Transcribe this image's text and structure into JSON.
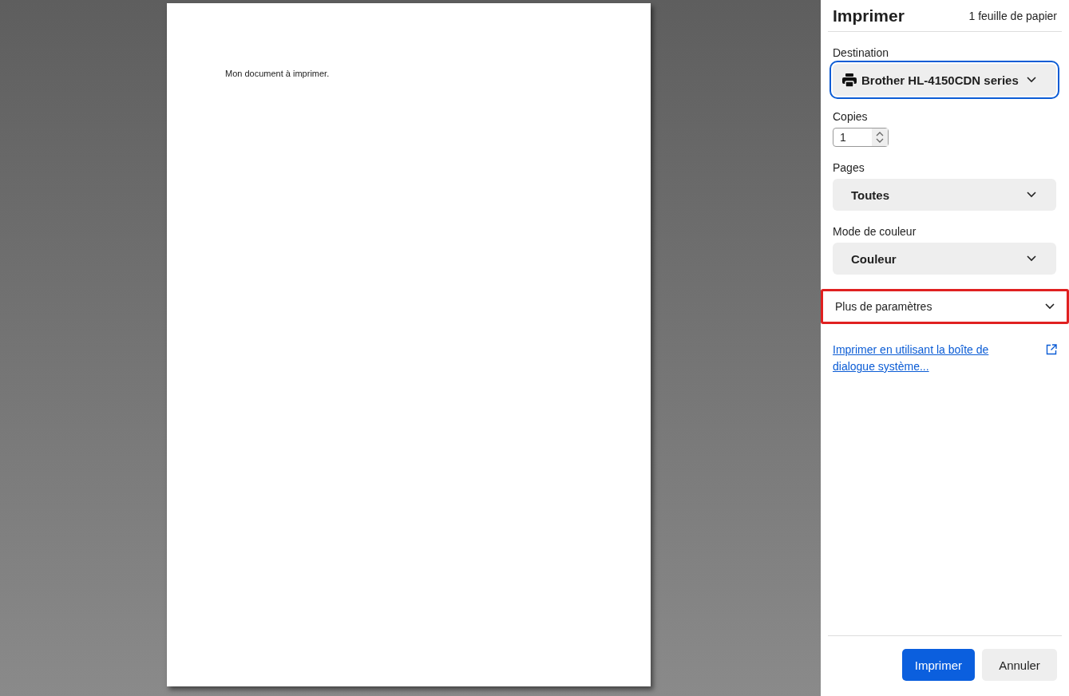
{
  "preview": {
    "page_text": "Mon document à imprimer."
  },
  "panel": {
    "title": "Imprimer",
    "sheet_count": "1 feuille de papier",
    "fields": [
      {
        "kind": "select",
        "label": "Destination",
        "value": "Brother HL-4150CDN series",
        "focused": true
      },
      {
        "kind": "number",
        "label": "Copies",
        "value": "1"
      },
      {
        "kind": "select",
        "label": "Pages",
        "value": "Toutes",
        "focused": false
      },
      {
        "kind": "select",
        "label": "Mode de couleur",
        "value": "Couleur",
        "focused": false
      }
    ],
    "more_settings": {
      "label": "Plus de paramètres",
      "expanded": false,
      "highlighted": true
    },
    "system_dialog_link": "Imprimer en utilisant la boîte de dialogue système...",
    "buttons": [
      {
        "label": "Imprimer",
        "kind": "primary"
      },
      {
        "label": "Annuler",
        "kind": "secondary"
      }
    ]
  }
}
